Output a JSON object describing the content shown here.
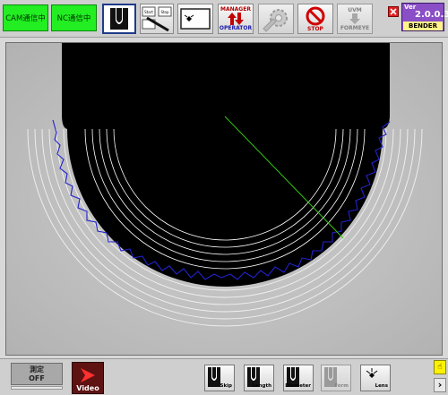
{
  "top_toolbar": {
    "cam_status": "CAM通信中",
    "nc_status": "NC通信中",
    "manager_label": "MANAGER",
    "operator_label": "OPERATOR",
    "stop_label": "STOP",
    "uvm_label": "UVM",
    "formeye_label": "FORMEYE",
    "mini_start_label": "Start",
    "mini_stop_label": "Stop"
  },
  "version": {
    "label": "Ver",
    "number": "2.0.0.3",
    "machine": "BENDER"
  },
  "bottom_toolbar": {
    "measure_title": "測定",
    "measure_state": "OFF",
    "video_label": "Video",
    "skip_label": "Skip",
    "length_label": "Length",
    "diameter_label": "Diameter",
    "form_label": "Form",
    "lens_label": "Lens",
    "next_glyph": "›"
  },
  "colors": {
    "status_green": "#22ee22",
    "accent_red": "#e02020",
    "version_purple": "#8a4ec6",
    "profile_blue": "#2222cc",
    "guide_green": "#33cc11"
  }
}
